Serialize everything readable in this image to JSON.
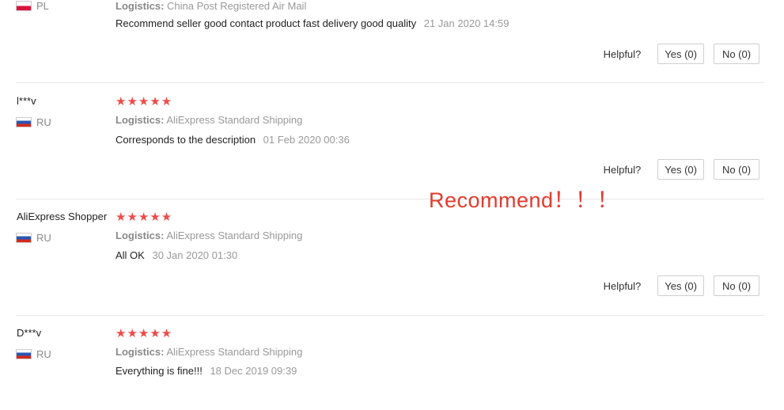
{
  "helpful_label": "Helpful?",
  "logistics_label": "Logistics:",
  "reviews": [
    {
      "country": "PL",
      "logistics": "China Post Registered Air Mail",
      "comment": "Recommend seller good contact product fast delivery good quality",
      "date": "21 Jan 2020 14:59",
      "yes": "Yes (0)",
      "no": "No (0)"
    },
    {
      "user": "l***v",
      "country": "RU",
      "stars": "★★★★★",
      "logistics": "AliExpress Standard Shipping",
      "comment": "Corresponds to the description",
      "date": "01 Feb 2020 00:36",
      "yes": "Yes (0)",
      "no": "No (0)"
    },
    {
      "user": "AliExpress Shopper",
      "country": "RU",
      "stars": "★★★★★",
      "logistics": "AliExpress Standard Shipping",
      "comment": "All OK",
      "date": "30 Jan 2020 01:30",
      "yes": "Yes (0)",
      "no": "No (0)"
    },
    {
      "user": "D***v",
      "country": "RU",
      "stars": "★★★★★",
      "logistics": "AliExpress Standard Shipping",
      "comment": "Everything is fine!!!",
      "date": "18 Dec 2019 09:39"
    }
  ],
  "overlay_text": "Recommend！！！",
  "colors": {
    "stars": "#f04a4a",
    "overlay": "#e23b2e",
    "divider": "#e8e8e8"
  }
}
